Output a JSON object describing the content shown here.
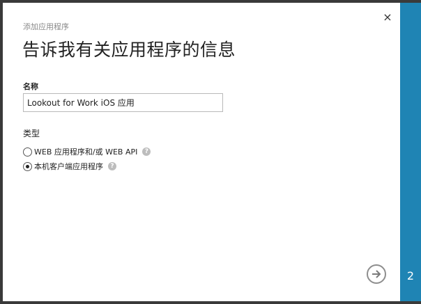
{
  "dialog": {
    "subtitle": "添加应用程序",
    "title": "告诉我有关应用程序的信息",
    "close_icon": "×"
  },
  "form": {
    "name_label": "名称",
    "name_value": "Lookout for Work iOS 应用",
    "type_label": "类型",
    "type_options": [
      {
        "label": "WEB 应用程序和/或 WEB API",
        "selected": false
      },
      {
        "label": "本机客户端应用程序",
        "selected": true
      }
    ],
    "help_glyph": "?"
  },
  "wizard": {
    "step_number": "2",
    "next_icon": "arrow-right-circle"
  },
  "colors": {
    "rail": "#1f84b4",
    "frame": "#3a3a3a"
  }
}
